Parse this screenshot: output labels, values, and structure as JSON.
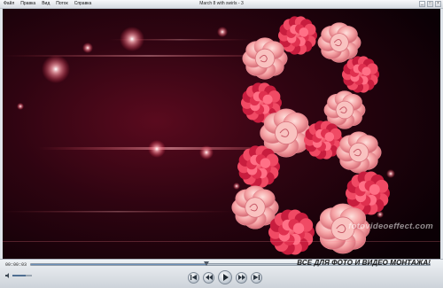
{
  "window": {
    "title": "March 8 with swirls - 3",
    "menu": [
      "Файл",
      "Правка",
      "Вид",
      "Поток",
      "Справка"
    ],
    "buttons": [
      "minimize-icon",
      "maximize-icon",
      "close-icon"
    ]
  },
  "video": {
    "watermark": "fotovideoeffect.com",
    "background_color": "#2a030f",
    "rose_light": "#f7a4a8",
    "carnation_red": "#e4314f"
  },
  "player": {
    "time": "00:00:03",
    "progress": 0.44,
    "volume": 0.7,
    "banner": "ВСЕ ДЛЯ ФОТО И ВИДЕО МОНТАЖА!",
    "controls": [
      "previous-icon",
      "rewind-icon",
      "play-icon",
      "fast-forward-icon",
      "next-icon"
    ]
  }
}
